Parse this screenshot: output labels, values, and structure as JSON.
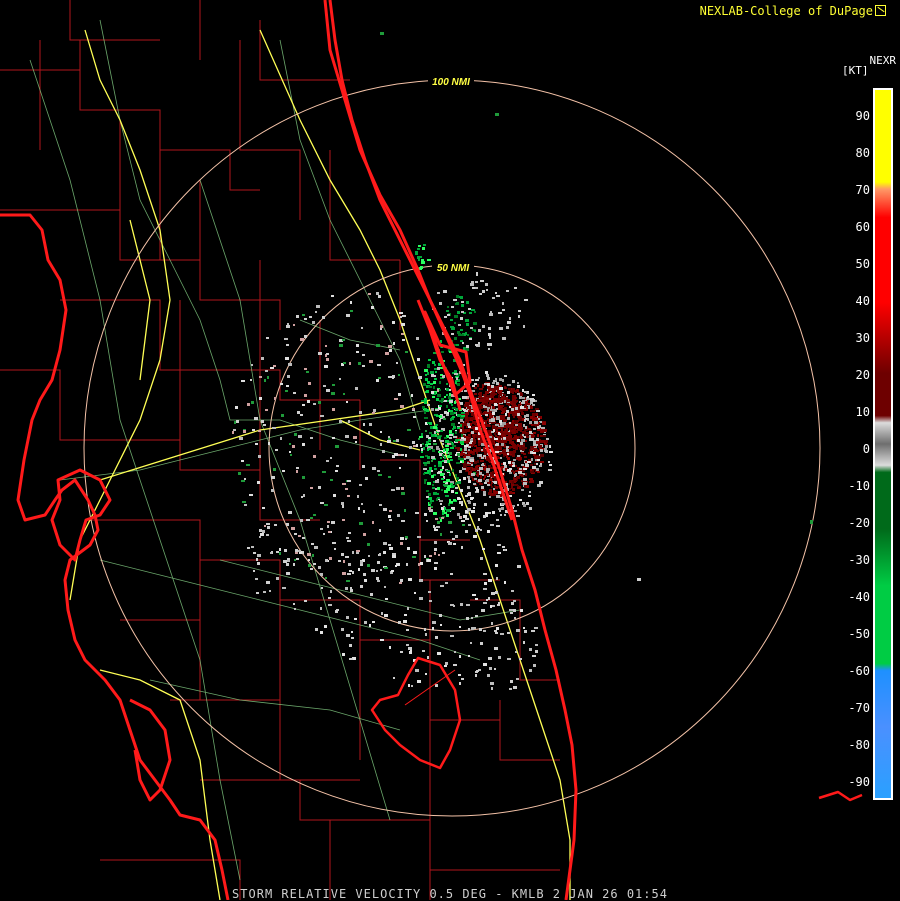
{
  "header": {
    "credit": "NEXLAB-College of DuPage"
  },
  "legend": {
    "product": "NEXR",
    "unit": "[KT]",
    "ticks": [
      "90",
      "80",
      "70",
      "60",
      "50",
      "40",
      "30",
      "20",
      "10",
      "0",
      "-10",
      "-20",
      "-30",
      "-40",
      "-50",
      "-60",
      "-70",
      "-80",
      "-90"
    ],
    "colors": {
      "inbound_deep": "#1e90ff",
      "inbound": "#00cc44",
      "inbound_dark": "#006a1a",
      "near_zero": "#cfcfcf",
      "outbound_dark": "#6e0000",
      "outbound": "#ff0000",
      "outbound_light": "#ff9966",
      "outbound_max": "#ffff00"
    }
  },
  "map": {
    "range_rings": [
      "100 NMI",
      "50 NMI"
    ],
    "colors": {
      "coast": "#ff1a1a",
      "counties": "#b0161c",
      "highways": "#ffff55",
      "roads": "#8fdf8f",
      "rings": "#f5c3a8"
    }
  },
  "footer": {
    "caption": "STORM RELATIVE VELOCITY 0.5 DEG - KMLB 2 JAN 26 01:54"
  }
}
